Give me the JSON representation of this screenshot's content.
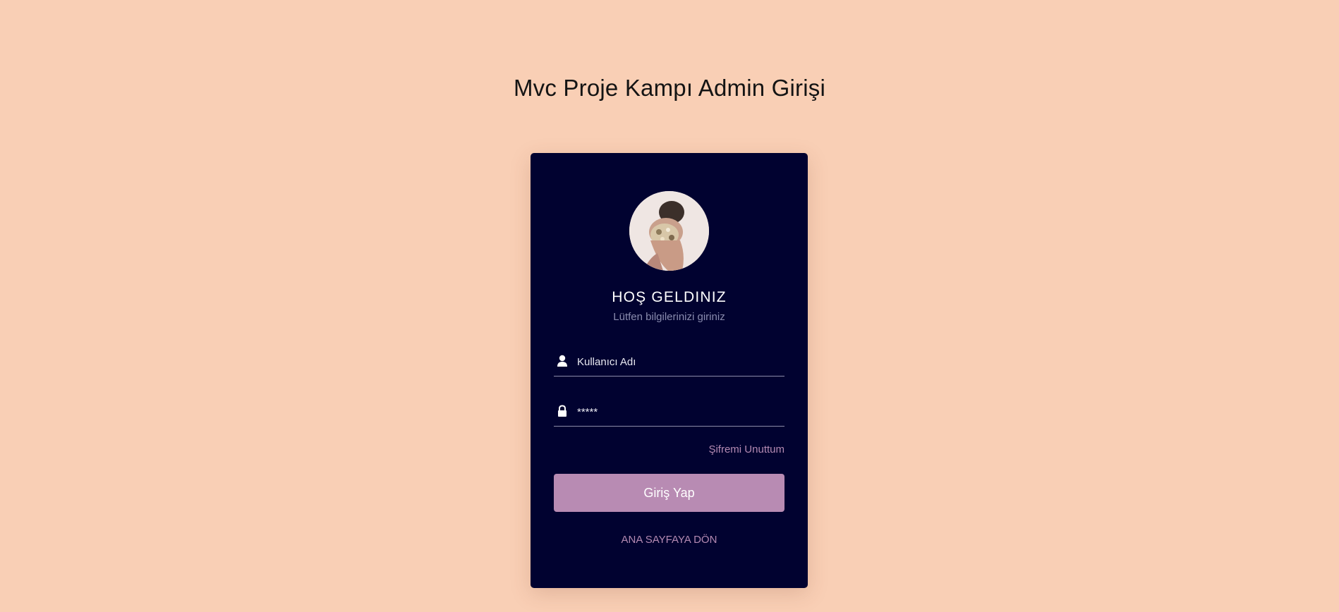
{
  "page": {
    "title": "Mvc Proje Kampı Admin Girişi"
  },
  "card": {
    "avatar": "avatar-photo",
    "heading": "HOŞ GELDINIZ",
    "subtitle": "Lütfen bilgilerinizi giriniz"
  },
  "form": {
    "username": {
      "icon": "user-icon",
      "placeholder": "Kullanıcı Adı",
      "value": ""
    },
    "password": {
      "icon": "lock-icon",
      "placeholder": "*****",
      "value": ""
    },
    "forgot_label": "Şifremi Unuttum",
    "submit_label": "Giriş Yap",
    "home_label": "ANA SAYFAYA DÖN"
  },
  "colors": {
    "background": "#f9cfb5",
    "card": "#010230",
    "accent": "#b88bb3"
  }
}
